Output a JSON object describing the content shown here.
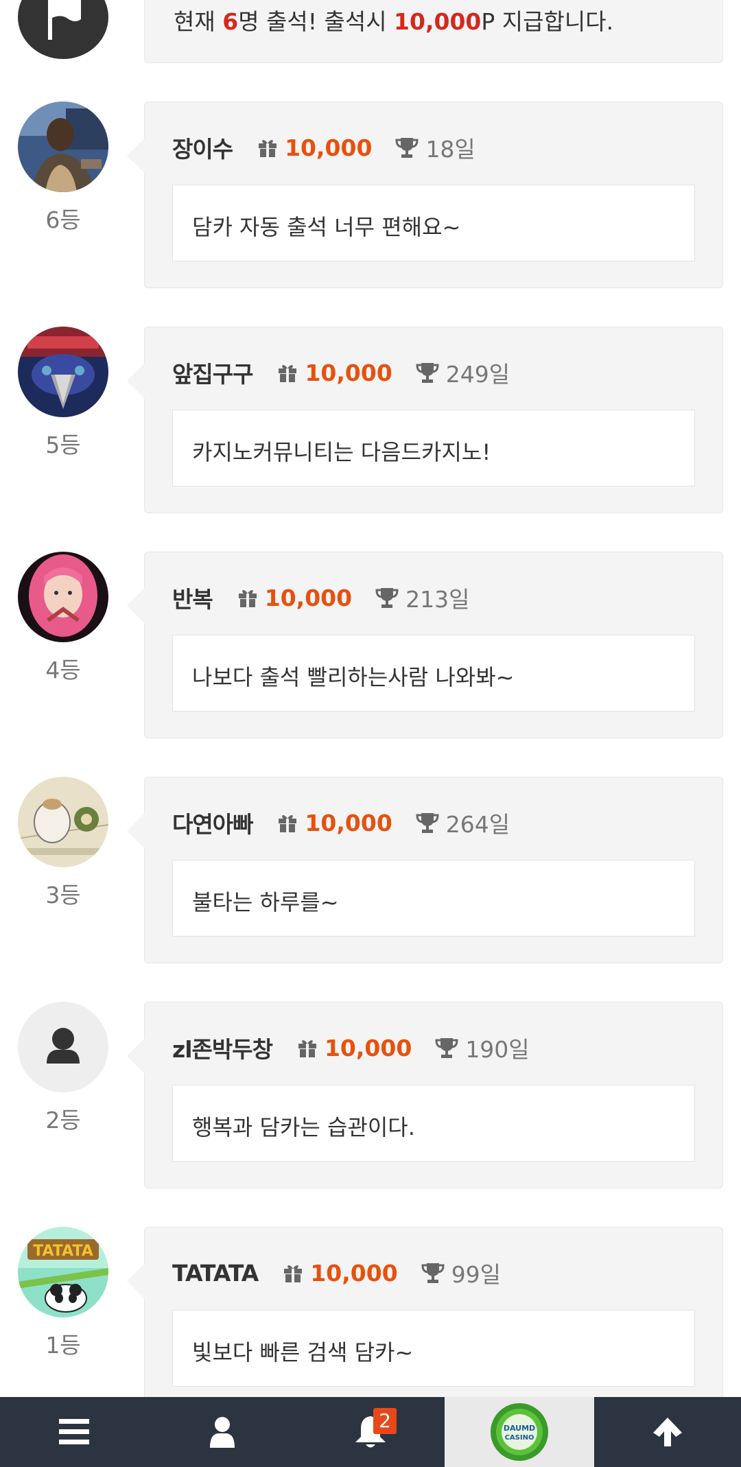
{
  "notice": {
    "prefix": "현재 ",
    "count": "6",
    "middle": "명 출석! 출석시 ",
    "points": "10,000",
    "suffix": "P 지급합니다.",
    "icon": "flag-icon"
  },
  "colors": {
    "points": "#e8500e",
    "highlight": "#d7271d",
    "bottombar": "#2b3440",
    "badge": "#e8471c"
  },
  "entries": [
    {
      "rank": "6등",
      "nickname": "장이수",
      "points": "10,000",
      "days": "18일",
      "message": "담카 자동 출석 너무 편해요~",
      "avatar": "photo-avatar"
    },
    {
      "rank": "5등",
      "nickname": "앞집구구",
      "points": "10,000",
      "days": "249일",
      "message": "카지노커뮤니티는 다음드카지노!",
      "avatar": "bird-avatar"
    },
    {
      "rank": "4등",
      "nickname": "반복",
      "points": "10,000",
      "days": "213일",
      "message": "나보다 출석 빨리하는사람 나와봐~",
      "avatar": "pink-hair-avatar"
    },
    {
      "rank": "3등",
      "nickname": "다연아빠",
      "points": "10,000",
      "days": "264일",
      "message": "불타는 하루를~",
      "avatar": "hamster-avatar"
    },
    {
      "rank": "2등",
      "nickname": "zl존박두창",
      "points": "10,000",
      "days": "190일",
      "message": "행복과 담카는 습관이다.",
      "avatar": "default-user-avatar"
    },
    {
      "rank": "1등",
      "nickname": "TATATA",
      "points": "10,000",
      "days": "99일",
      "message": "빛보다 빠른 검색 담카~",
      "avatar": "tatata-avatar",
      "avatar_text": "TATATA"
    }
  ],
  "bottombar": {
    "items": [
      {
        "name": "menu",
        "icon": "hamburger-menu-icon"
      },
      {
        "name": "user",
        "icon": "user-icon"
      },
      {
        "name": "notifications",
        "icon": "bell-icon",
        "badge": "2"
      },
      {
        "name": "logo",
        "icon": "daumd-casino-logo",
        "logo_text_1": "DAUMD",
        "logo_text_2": "CASINO"
      },
      {
        "name": "scroll-top",
        "icon": "arrow-up-icon"
      }
    ]
  }
}
